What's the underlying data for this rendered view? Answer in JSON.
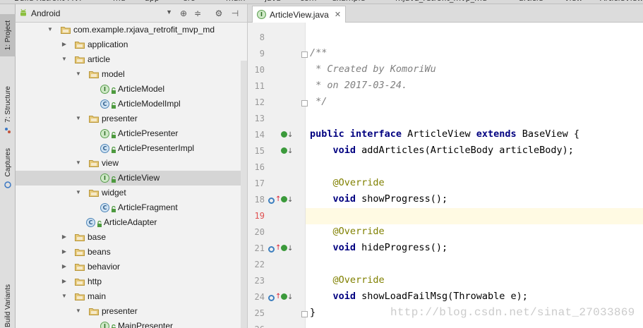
{
  "top_strip": {
    "crumbs": [
      "Build Retrofit MVP",
      "md",
      "app",
      "src",
      "main",
      "java",
      "com",
      "example",
      "rxjava_retrofit_mvp_md",
      "article",
      "view",
      "ArticleView"
    ]
  },
  "left_strip": {
    "tabs": [
      {
        "label": "1: Project",
        "active": true
      },
      {
        "label": "7: Structure",
        "active": false
      },
      {
        "label": "Captures",
        "active": false
      },
      {
        "label": "Build Variants",
        "active": false
      }
    ]
  },
  "project_panel": {
    "view_mode": "Android",
    "header_icons": [
      "target-icon",
      "collapse-icon",
      "gear-icon",
      "hide-icon"
    ],
    "tree": [
      {
        "label": "com.example.rxjava_retrofit_mvp_md",
        "type": "package",
        "depth": 2,
        "expanded": true
      },
      {
        "label": "application",
        "type": "package",
        "depth": 3,
        "expanded": false
      },
      {
        "label": "article",
        "type": "package",
        "depth": 3,
        "expanded": true
      },
      {
        "label": "model",
        "type": "package",
        "depth": 4,
        "expanded": true
      },
      {
        "label": "ArticleModel",
        "type": "interface",
        "depth": 5
      },
      {
        "label": "ArticleModelImpl",
        "type": "class",
        "depth": 5
      },
      {
        "label": "presenter",
        "type": "package",
        "depth": 4,
        "expanded": true
      },
      {
        "label": "ArticlePresenter",
        "type": "interface",
        "depth": 5
      },
      {
        "label": "ArticlePresenterImpl",
        "type": "class",
        "depth": 5
      },
      {
        "label": "view",
        "type": "package",
        "depth": 4,
        "expanded": true
      },
      {
        "label": "ArticleView",
        "type": "interface",
        "depth": 5,
        "selected": true
      },
      {
        "label": "widget",
        "type": "package",
        "depth": 4,
        "expanded": true
      },
      {
        "label": "ArticleFragment",
        "type": "class",
        "depth": 5
      },
      {
        "label": "ArticleAdapter",
        "type": "class",
        "depth": 4
      },
      {
        "label": "base",
        "type": "package",
        "depth": 3,
        "expanded": false
      },
      {
        "label": "beans",
        "type": "package",
        "depth": 3,
        "expanded": false
      },
      {
        "label": "behavior",
        "type": "package",
        "depth": 3,
        "expanded": false
      },
      {
        "label": "http",
        "type": "package",
        "depth": 3,
        "expanded": false
      },
      {
        "label": "main",
        "type": "package",
        "depth": 3,
        "expanded": true
      },
      {
        "label": "presenter",
        "type": "package",
        "depth": 4,
        "expanded": true
      },
      {
        "label": "MainPresenter",
        "type": "interface",
        "depth": 5
      }
    ]
  },
  "editor": {
    "tab_label": "ArticleView.java",
    "tab_badge": "I",
    "lines": [
      {
        "n": "8",
        "text": ""
      },
      {
        "n": "9",
        "text": "/**",
        "kind": "comment"
      },
      {
        "n": "10",
        "text": " * Created by KomoriWu",
        "kind": "comment"
      },
      {
        "n": "11",
        "text": " * on 2017-03-24.",
        "kind": "comment"
      },
      {
        "n": "12",
        "text": " */",
        "kind": "comment"
      },
      {
        "n": "13",
        "text": ""
      },
      {
        "n": "14",
        "kw1": "public interface",
        "mid": " ArticleView ",
        "kw2": "extends",
        "rest": " BaseView {",
        "kind": "decl",
        "marker": "impl"
      },
      {
        "n": "15",
        "kw1": "    void",
        "rest": " addArticles(ArticleBody articleBody);",
        "kind": "method",
        "marker": "impl"
      },
      {
        "n": "16",
        "text": ""
      },
      {
        "n": "17",
        "text": "    @Override",
        "kind": "annotation"
      },
      {
        "n": "18",
        "kw1": "    void",
        "rest": " showProgress();",
        "kind": "method",
        "marker": "override"
      },
      {
        "n": "19",
        "text": "",
        "current": true
      },
      {
        "n": "20",
        "text": "    @Override",
        "kind": "annotation"
      },
      {
        "n": "21",
        "kw1": "    void",
        "rest": " hideProgress();",
        "kind": "method",
        "marker": "override"
      },
      {
        "n": "22",
        "text": ""
      },
      {
        "n": "23",
        "text": "    @Override",
        "kind": "annotation"
      },
      {
        "n": "24",
        "kw1": "    void",
        "rest": " showLoadFailMsg(Throwable e);",
        "kind": "method",
        "marker": "override"
      },
      {
        "n": "25",
        "text": "}"
      },
      {
        "n": "26",
        "text": ""
      }
    ],
    "watermark": "http://blog.csdn.net/sinat_27033869"
  },
  "colors": {
    "keyword": "#000080",
    "comment": "#808080",
    "annotation": "#808000",
    "current_line_number": "#e05050",
    "current_line_bg": "#fffae3"
  }
}
